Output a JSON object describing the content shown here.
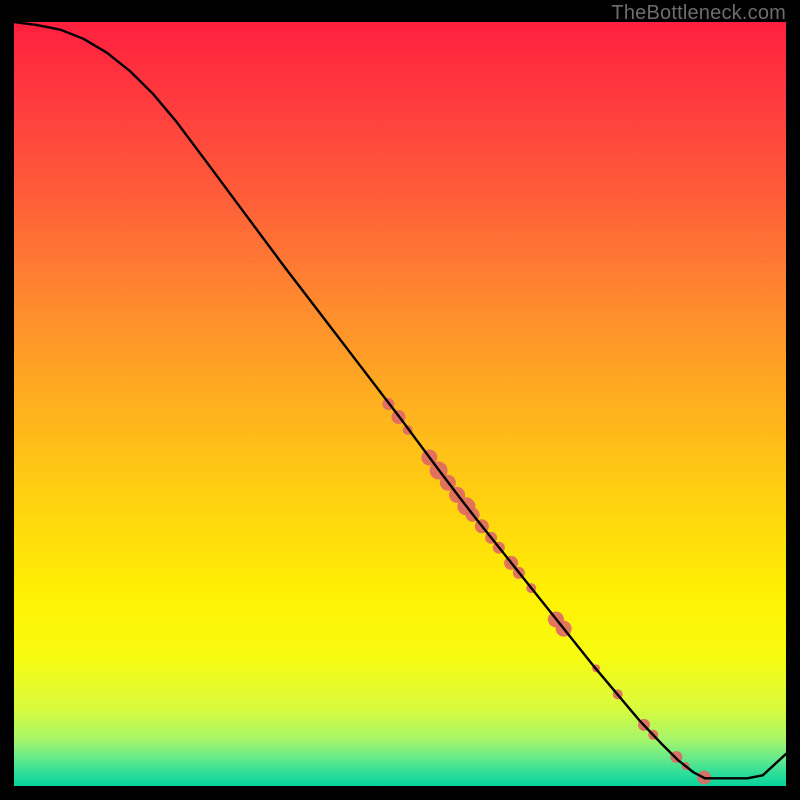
{
  "watermark": "TheBottleneck.com",
  "gradient": {
    "stops": [
      {
        "offset": 0.0,
        "color": "#ff1f3f"
      },
      {
        "offset": 0.1,
        "color": "#ff3a3e"
      },
      {
        "offset": 0.22,
        "color": "#ff5b3a"
      },
      {
        "offset": 0.35,
        "color": "#ff8430"
      },
      {
        "offset": 0.48,
        "color": "#ffaa22"
      },
      {
        "offset": 0.62,
        "color": "#ffd010"
      },
      {
        "offset": 0.75,
        "color": "#fff104"
      },
      {
        "offset": 0.83,
        "color": "#f7fb10"
      },
      {
        "offset": 0.9,
        "color": "#d8fb3e"
      },
      {
        "offset": 0.94,
        "color": "#a4f56a"
      },
      {
        "offset": 0.965,
        "color": "#62e98c"
      },
      {
        "offset": 0.985,
        "color": "#29dd9a"
      },
      {
        "offset": 1.0,
        "color": "#08d49b"
      }
    ]
  },
  "chart_data": {
    "type": "line",
    "title": "",
    "xlabel": "",
    "ylabel": "",
    "xlim": [
      0,
      100
    ],
    "ylim": [
      0,
      100
    ],
    "series": [
      {
        "name": "curve",
        "x": [
          0,
          3,
          6,
          9,
          12,
          15,
          18,
          21,
          25,
          30,
          35,
          40,
          45,
          50,
          55,
          58,
          60,
          63,
          66,
          69,
          72,
          75,
          78,
          81,
          84,
          86,
          88,
          89.5,
          92,
          95,
          97,
          100
        ],
        "y": [
          100,
          99.6,
          99.0,
          97.8,
          96.0,
          93.6,
          90.6,
          87.0,
          81.6,
          74.8,
          68.0,
          61.4,
          54.8,
          48.2,
          41.4,
          37.4,
          34.8,
          31.0,
          27.2,
          23.4,
          19.6,
          15.8,
          12.2,
          8.6,
          5.4,
          3.4,
          1.8,
          1.0,
          1.0,
          1.0,
          1.4,
          4.2
        ]
      }
    ],
    "markers": [
      {
        "x": 48.5,
        "y": 50.0,
        "r": 6
      },
      {
        "x": 49.8,
        "y": 48.3,
        "r": 7
      },
      {
        "x": 51.0,
        "y": 46.6,
        "r": 5
      },
      {
        "x": 53.8,
        "y": 43.0,
        "r": 8
      },
      {
        "x": 55.0,
        "y": 41.3,
        "r": 9
      },
      {
        "x": 56.2,
        "y": 39.7,
        "r": 8
      },
      {
        "x": 57.4,
        "y": 38.1,
        "r": 8
      },
      {
        "x": 58.6,
        "y": 36.6,
        "r": 9
      },
      {
        "x": 59.4,
        "y": 35.5,
        "r": 7
      },
      {
        "x": 60.6,
        "y": 34.0,
        "r": 7
      },
      {
        "x": 61.8,
        "y": 32.5,
        "r": 6
      },
      {
        "x": 62.8,
        "y": 31.2,
        "r": 6
      },
      {
        "x": 64.4,
        "y": 29.2,
        "r": 7
      },
      {
        "x": 65.4,
        "y": 27.9,
        "r": 6
      },
      {
        "x": 67.0,
        "y": 25.9,
        "r": 5
      },
      {
        "x": 70.2,
        "y": 21.8,
        "r": 8
      },
      {
        "x": 71.2,
        "y": 20.6,
        "r": 8
      },
      {
        "x": 75.4,
        "y": 15.4,
        "r": 4
      },
      {
        "x": 78.2,
        "y": 12.0,
        "r": 5
      },
      {
        "x": 81.6,
        "y": 8.0,
        "r": 6
      },
      {
        "x": 82.8,
        "y": 6.7,
        "r": 5
      },
      {
        "x": 85.8,
        "y": 3.8,
        "r": 6
      },
      {
        "x": 87.0,
        "y": 2.6,
        "r": 4
      },
      {
        "x": 89.4,
        "y": 1.1,
        "r": 7
      }
    ],
    "marker_color": "#e06963"
  }
}
